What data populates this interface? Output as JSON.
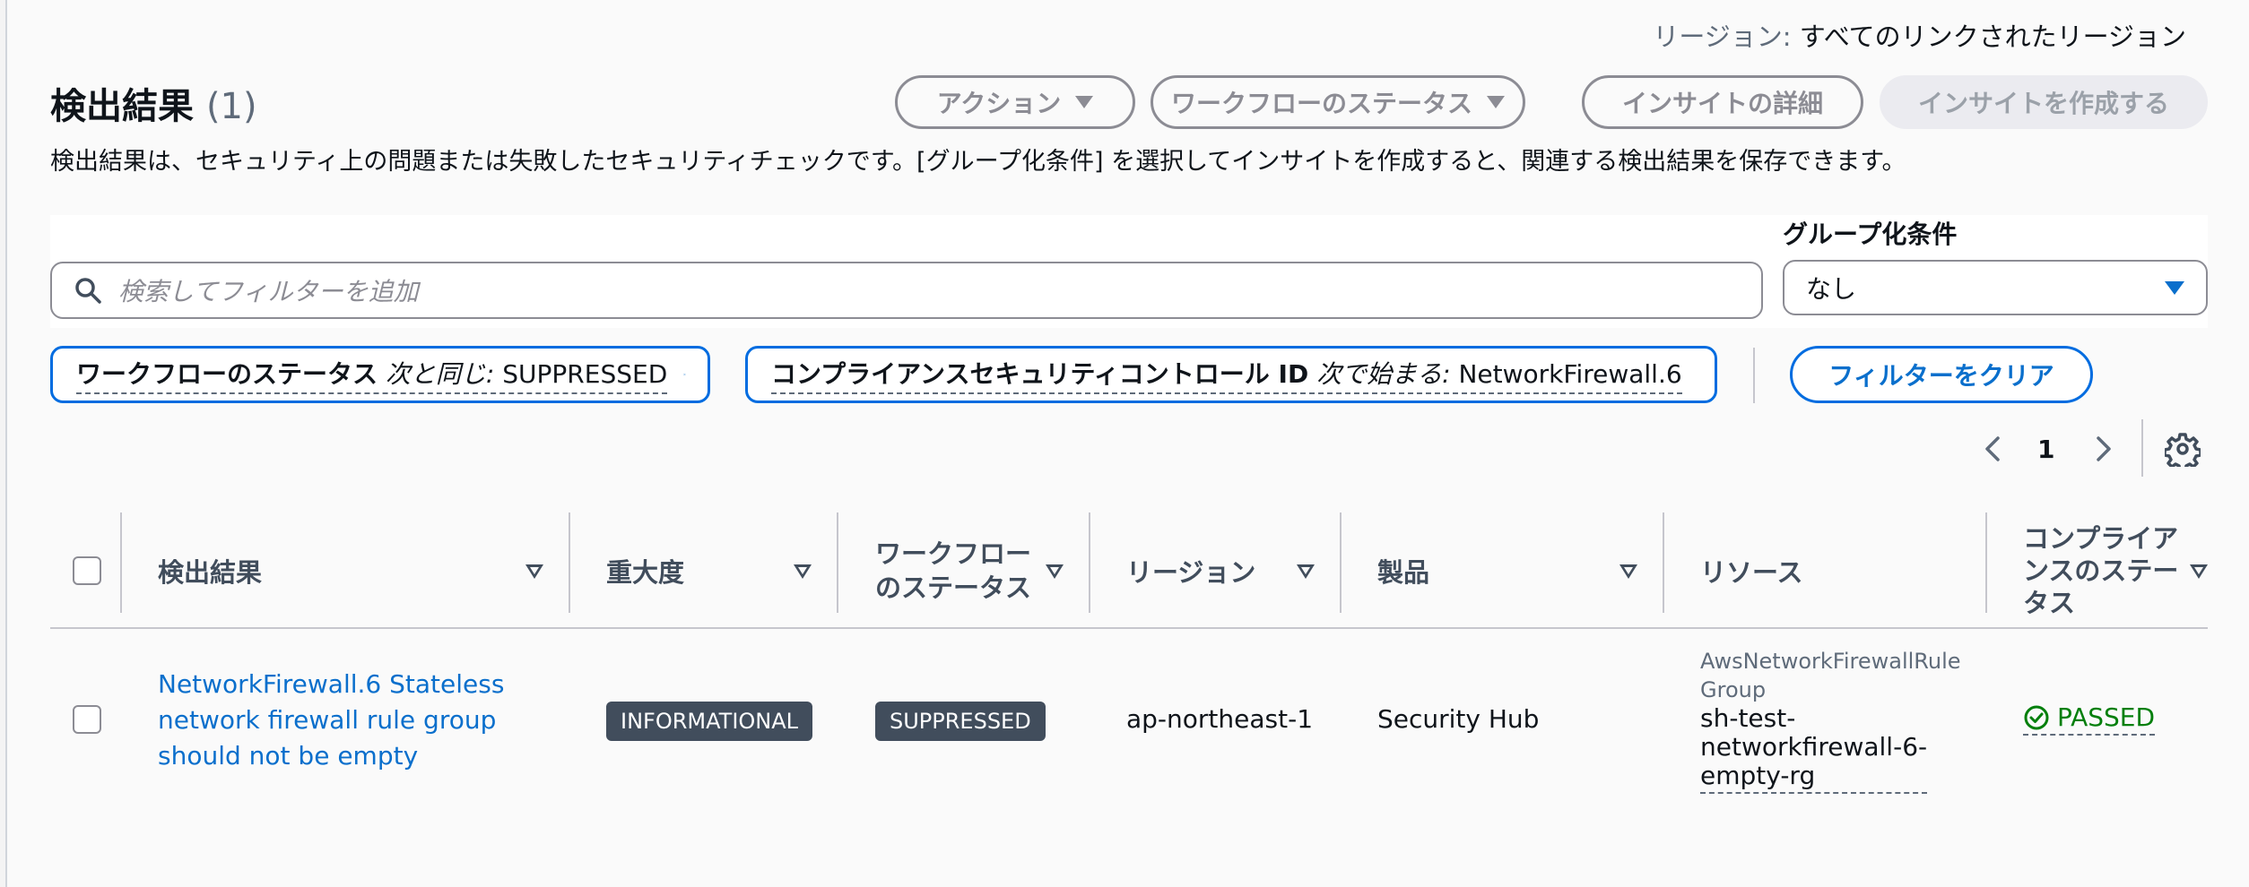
{
  "header": {
    "region_label": "リージョン:",
    "region_value": "すべてのリンクされたリージョン",
    "title": "検出結果",
    "count": "(1)",
    "description": "検出結果は、セキュリティ上の問題または失敗したセキュリティチェックです。[グループ化条件] を選択してインサイトを作成すると、関連する検出結果を保存できます。"
  },
  "toolbar": {
    "actions_label": "アクション",
    "workflow_status_label": "ワークフローのステータス",
    "insight_details_label": "インサイトの詳細",
    "create_insight_label": "インサイトを作成する"
  },
  "search": {
    "placeholder": "検索してフィルターを追加"
  },
  "group_by": {
    "label": "グループ化条件",
    "value": "なし"
  },
  "filters": [
    {
      "key": "ワークフローのステータス",
      "operator": "次と同じ:",
      "value": "SUPPRESSED"
    },
    {
      "key": "コンプライアンスセキュリティコントロール ID",
      "operator": "次で始まる:",
      "value": "NetworkFirewall.6"
    }
  ],
  "clear_filters_label": "フィルターをクリア",
  "pagination": {
    "current_page": "1"
  },
  "table": {
    "columns": [
      "検出結果",
      "重大度",
      "ワークフローのステータス",
      "リージョン",
      "製品",
      "リソース",
      "コンプライアンスのステータス"
    ],
    "column_lines": {
      "workflow": [
        "ワークフロー",
        "のステータス"
      ],
      "compliance": [
        "コンプライア",
        "ンスのステー",
        "タス"
      ]
    },
    "rows": [
      {
        "finding_lines": [
          "NetworkFirewall.6 Stateless",
          "network firewall rule group",
          "should not be empty"
        ],
        "severity": "INFORMATIONAL",
        "workflow_status": "SUPPRESSED",
        "region": "ap-northeast-1",
        "product": "Security Hub",
        "resource_type_lines": [
          "AwsNetworkFirewallRule",
          "Group"
        ],
        "resource_name_lines": [
          "sh-test-",
          "networkfirewall-6-",
          "empty-rg"
        ],
        "compliance": "PASSED"
      }
    ]
  },
  "colors": {
    "accent": "#0a6fcc",
    "badge_bg": "#414d5c",
    "passed": "#037f0c"
  }
}
